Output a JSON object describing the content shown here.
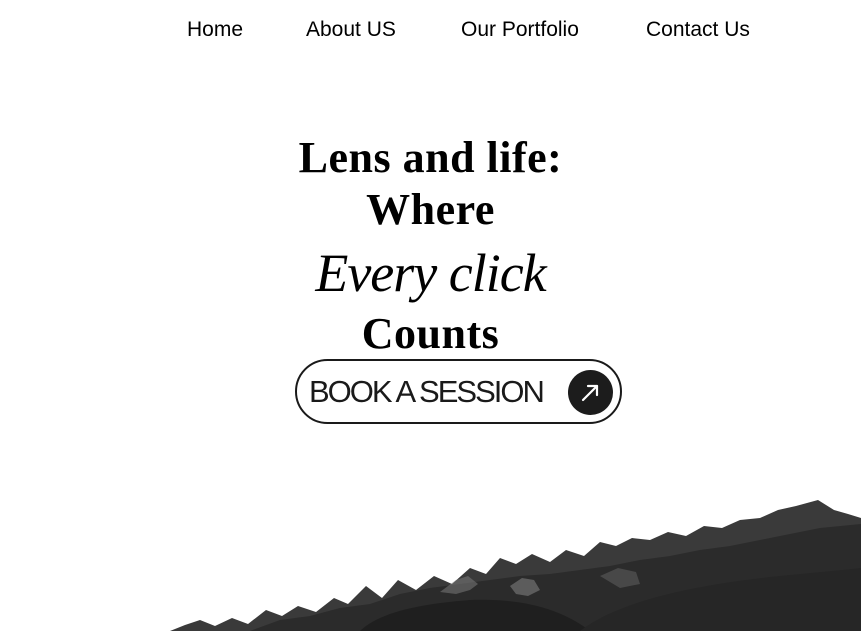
{
  "nav": {
    "items": [
      {
        "label": "Home"
      },
      {
        "label": "About US"
      },
      {
        "label": "Our Portfolio"
      },
      {
        "label": "Contact Us"
      }
    ]
  },
  "hero": {
    "line1": "Lens and life:",
    "line2": "Where",
    "line3": "Every click",
    "line4": "Counts"
  },
  "cta": {
    "label": "BOOK A SESSION",
    "icon": "arrow-up-right-icon"
  },
  "colors": {
    "text": "#000000",
    "button_border": "#1a1a1a",
    "button_circle": "#1c1c1c",
    "mountain_dark": "#2a2a2a",
    "mountain_mid": "#3d3d3d",
    "mountain_light": "#6e6e6e"
  }
}
